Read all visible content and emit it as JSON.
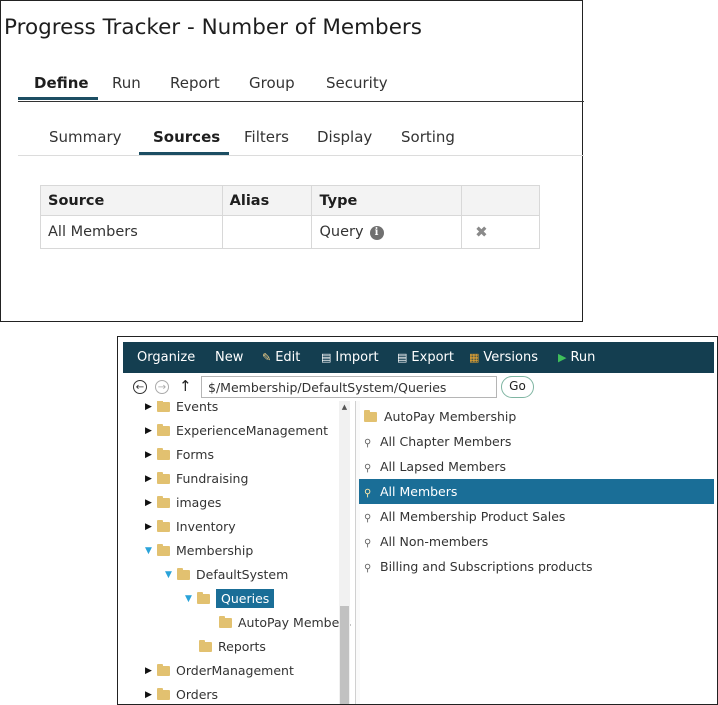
{
  "page_title": "Progress Tracker - Number of Members",
  "main_tabs": [
    "Define",
    "Run",
    "Report",
    "Group",
    "Security"
  ],
  "sub_tabs": [
    "Summary",
    "Sources",
    "Filters",
    "Display",
    "Sorting"
  ],
  "sources_table": {
    "headers": [
      "Source",
      "Alias",
      "Type",
      ""
    ],
    "rows": [
      {
        "source": "All Members",
        "alias": "",
        "type": "Query"
      }
    ]
  },
  "toolbar": {
    "organize": "Organize",
    "new": "New",
    "edit": "Edit",
    "import": "Import",
    "export": "Export",
    "versions": "Versions",
    "run": "Run"
  },
  "address": {
    "path": "$/Membership/DefaultSystem/Queries",
    "go": "Go"
  },
  "tree": [
    {
      "label": "Events",
      "expanded": false
    },
    {
      "label": "ExperienceManagement",
      "expanded": false
    },
    {
      "label": "Forms",
      "expanded": false
    },
    {
      "label": "Fundraising",
      "expanded": false
    },
    {
      "label": "images",
      "expanded": false
    },
    {
      "label": "Inventory",
      "expanded": false
    },
    {
      "label": "Membership",
      "expanded": true
    },
    {
      "label": "DefaultSystem",
      "expanded": true
    },
    {
      "label": "Queries",
      "expanded": true,
      "selected": true
    },
    {
      "label": "AutoPay Members"
    },
    {
      "label": "Reports"
    },
    {
      "label": "OrderManagement",
      "expanded": false
    },
    {
      "label": "Orders",
      "expanded": false
    }
  ],
  "list": [
    {
      "label": "AutoPay Membership",
      "kind": "folder"
    },
    {
      "label": "All Chapter Members",
      "kind": "query"
    },
    {
      "label": "All Lapsed Members",
      "kind": "query"
    },
    {
      "label": "All Members",
      "kind": "query",
      "selected": true
    },
    {
      "label": "All Membership Product Sales",
      "kind": "query"
    },
    {
      "label": "All Non-members",
      "kind": "query"
    },
    {
      "label": "Billing and Subscriptions products",
      "kind": "query"
    }
  ],
  "colors": {
    "toolbar_bg": "#143e50",
    "selection": "#1a6e97",
    "tab_underline": "#1c4e63",
    "folder": "#e2c170"
  }
}
